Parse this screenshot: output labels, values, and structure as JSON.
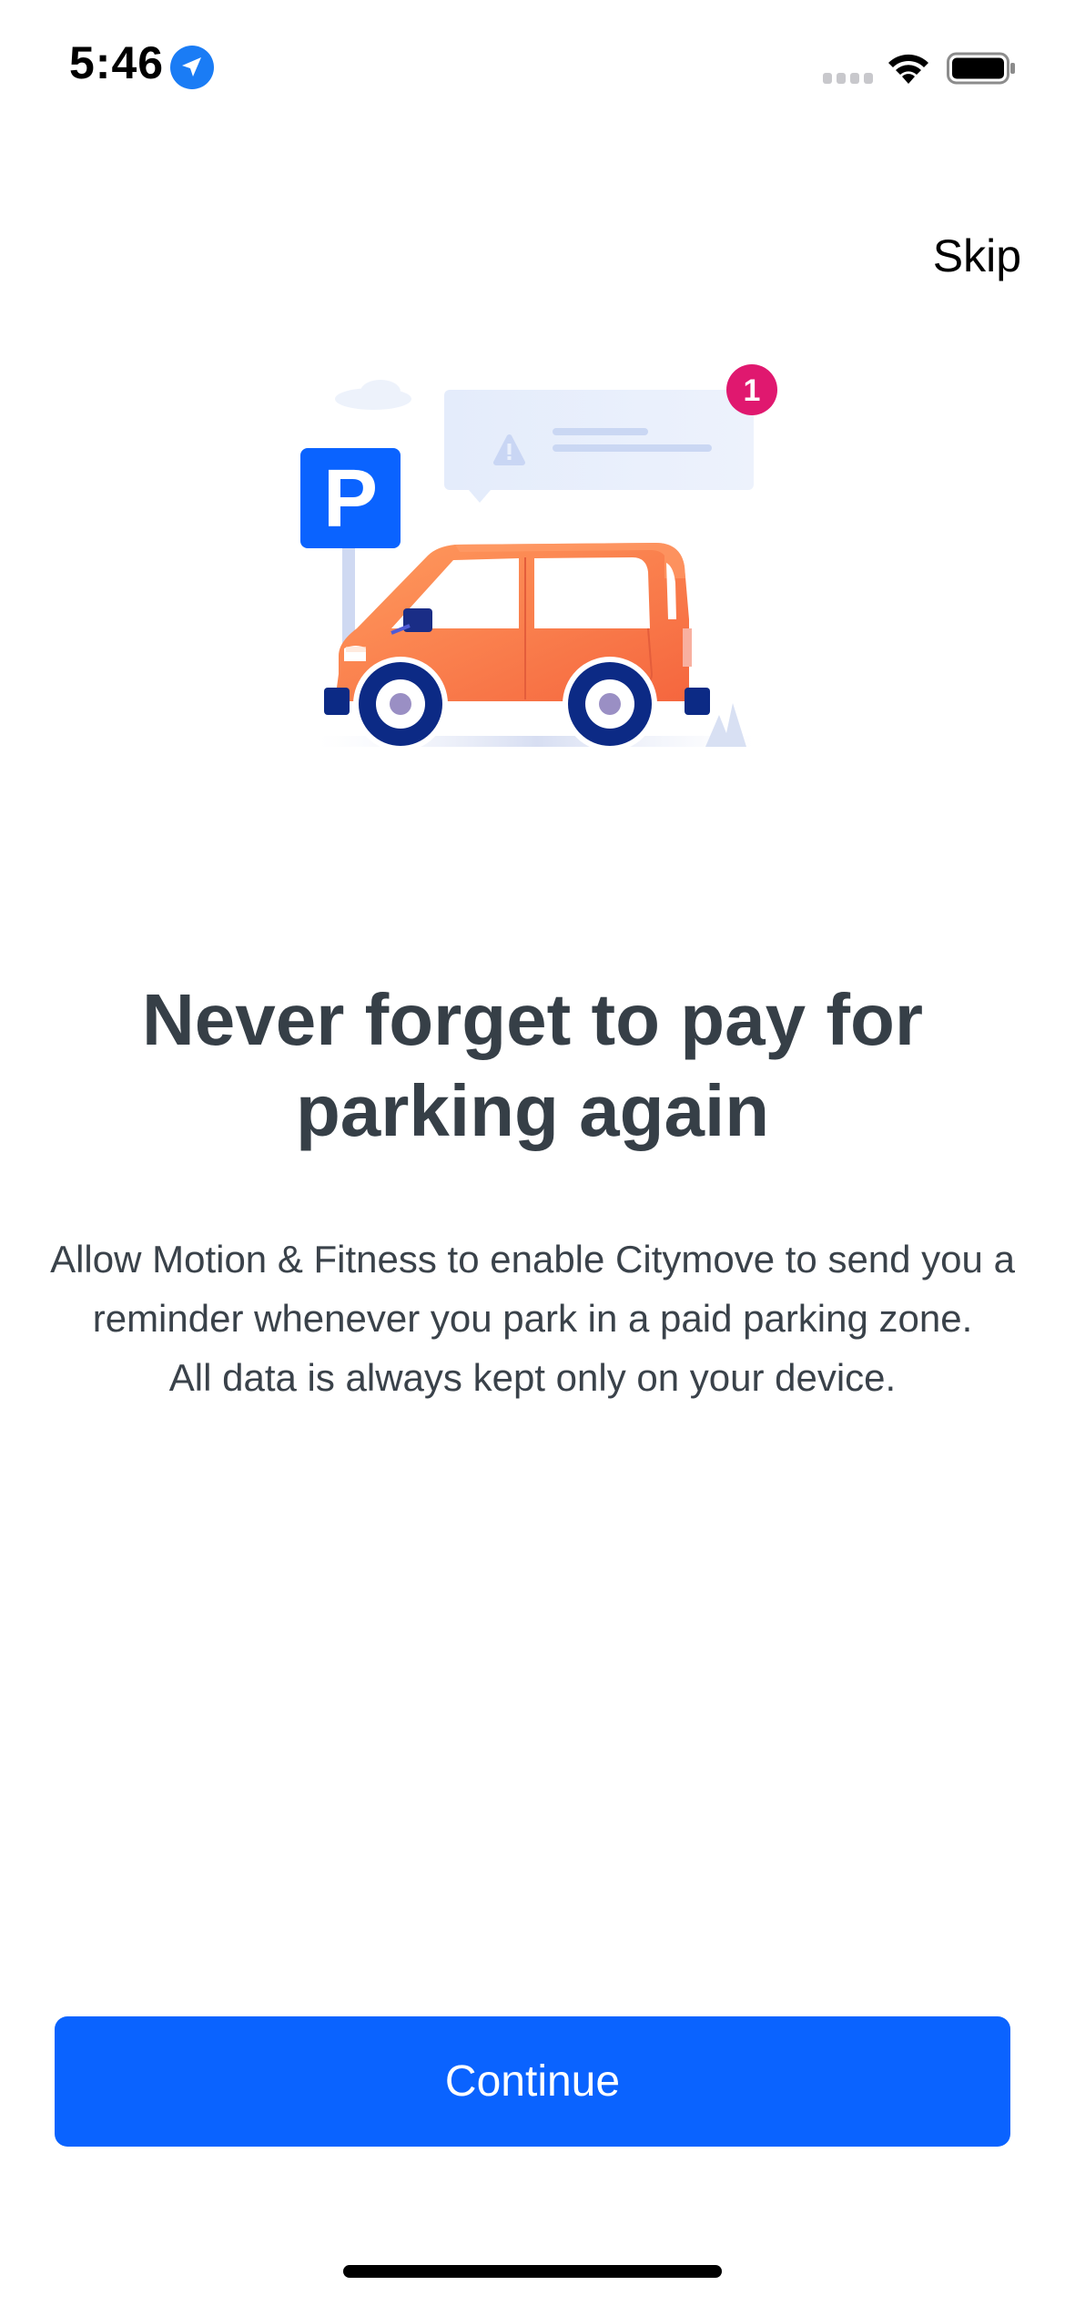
{
  "status_bar": {
    "time": "5:46",
    "icons": [
      "location-arrow-icon",
      "cellular-signal-icon",
      "wifi-icon",
      "battery-icon"
    ]
  },
  "header": {
    "skip_label": "Skip"
  },
  "illustration": {
    "parking_sign_letter": "P",
    "notification_count": "1",
    "icons": [
      "parking-sign-icon",
      "warning-icon",
      "car-icon",
      "notification-badge-icon"
    ]
  },
  "content": {
    "title": "Never forget to pay for parking again",
    "body_lines": [
      "Allow Motion & Fitness to enable Citymove to send you a reminder whenever you park in a paid parking zone.",
      "All data is always kept only on your device."
    ]
  },
  "footer": {
    "continue_label": "Continue"
  },
  "colors": {
    "accent": "#0a63ff",
    "title_text": "#363f47",
    "badge": "#e0186f",
    "car_orange": "#fa7f4c",
    "sign_blue": "#0a63ff"
  }
}
